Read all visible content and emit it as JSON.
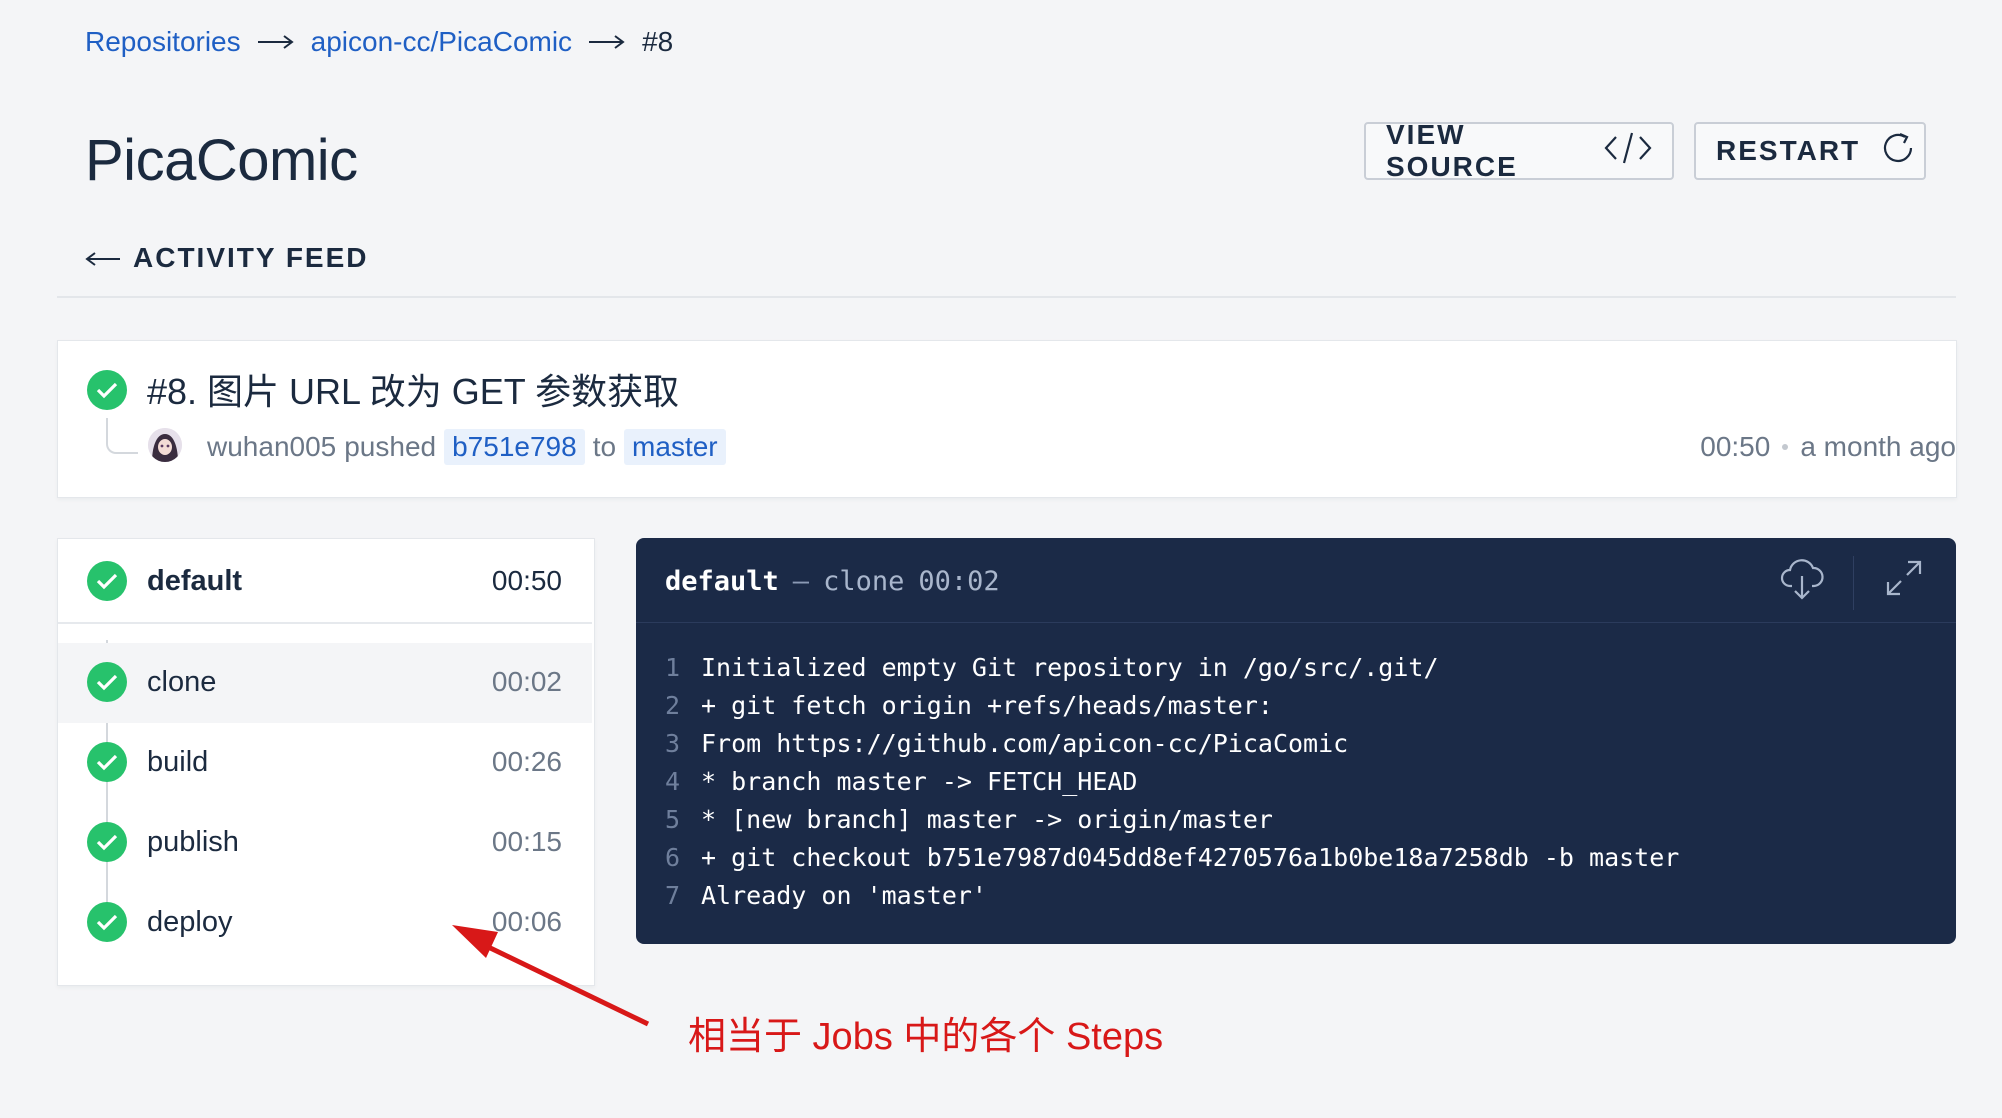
{
  "breadcrumb": {
    "items": [
      "Repositories",
      "apicon-cc/PicaComic"
    ],
    "current": "#8"
  },
  "repo": {
    "title": "PicaComic"
  },
  "actions": {
    "view_source": "VIEW SOURCE",
    "restart": "RESTART"
  },
  "back_link": "ACTIVITY FEED",
  "build": {
    "title": "#8. 图片 URL 改为 GET 参数获取",
    "author": "wuhan005",
    "action": "pushed",
    "commit": "b751e798",
    "to_word": "to",
    "branch": "master",
    "duration": "00:50",
    "time_ago": "a month ago",
    "status_color": "#27c26c"
  },
  "stage": {
    "name": "default",
    "duration": "00:50"
  },
  "steps": [
    {
      "name": "clone",
      "duration": "00:02"
    },
    {
      "name": "build",
      "duration": "00:26"
    },
    {
      "name": "publish",
      "duration": "00:15"
    },
    {
      "name": "deploy",
      "duration": "00:06"
    }
  ],
  "log": {
    "stage": "default",
    "separator": "—",
    "step": "clone",
    "duration": "00:02",
    "lines": [
      {
        "n": "1",
        "text": "Initialized empty Git repository in /go/src/.git/"
      },
      {
        "n": "2",
        "text": "+ git fetch origin +refs/heads/master:"
      },
      {
        "n": "3",
        "text": "From https://github.com/apicon-cc/PicaComic"
      },
      {
        "n": "4",
        "text": "* branch master -> FETCH_HEAD"
      },
      {
        "n": "5",
        "text": "* [new branch] master -> origin/master"
      },
      {
        "n": "6",
        "text": "+ git checkout b751e7987d045dd8ef4270576a1b0be18a7258db -b master"
      },
      {
        "n": "7",
        "text": "Already on 'master'"
      }
    ]
  },
  "annotation": {
    "text": "相当于 Jobs 中的各个 Steps",
    "color": "#d81818"
  },
  "icons": [
    "arrow-right-icon",
    "code-icon",
    "refresh-icon",
    "arrow-left-icon",
    "check-icon",
    "download-cloud-icon",
    "expand-icon"
  ]
}
